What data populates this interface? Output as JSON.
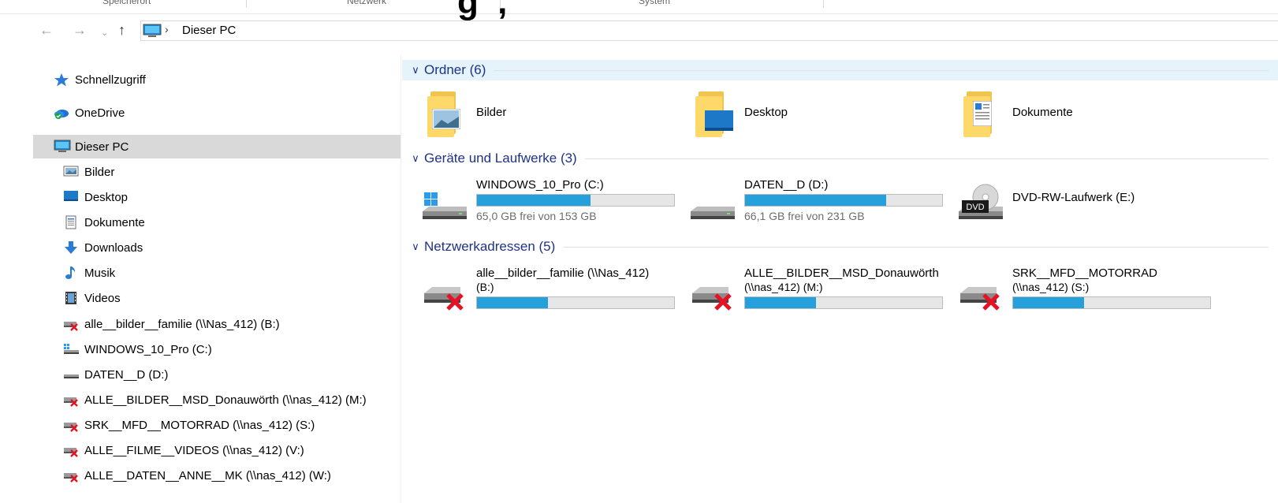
{
  "top_strip": {
    "labels": [
      "Speicherort",
      "Netzwerk",
      "System"
    ],
    "overlay_text": "g    ,"
  },
  "address": {
    "path": "Dieser PC"
  },
  "sidebar": {
    "items": [
      {
        "label": "Schnellzugriff",
        "icon": "star-icon"
      },
      {
        "label": "OneDrive",
        "icon": "onedrive-cloud-icon"
      },
      {
        "label": "Dieser PC",
        "icon": "this-pc-icon",
        "selected": true
      },
      {
        "label": "Bilder",
        "icon": "pictures-icon"
      },
      {
        "label": "Desktop",
        "icon": "desktop-icon"
      },
      {
        "label": "Dokumente",
        "icon": "documents-icon"
      },
      {
        "label": "Downloads",
        "icon": "downloads-icon"
      },
      {
        "label": "Musik",
        "icon": "music-icon"
      },
      {
        "label": "Videos",
        "icon": "videos-icon"
      },
      {
        "label": "alle__bilder__familie (\\\\Nas_412) (B:)",
        "icon": "disconnected-network-drive-icon"
      },
      {
        "label": "WINDOWS_10_Pro (C:)",
        "icon": "windows-drive-icon"
      },
      {
        "label": "DATEN__D (D:)",
        "icon": "drive-icon"
      },
      {
        "label": "ALLE__BILDER__MSD_Donauwörth (\\\\nas_412) (M:)",
        "icon": "disconnected-network-drive-icon"
      },
      {
        "label": "SRK__MFD__MOTORRAD (\\\\nas_412) (S:)",
        "icon": "disconnected-network-drive-icon"
      },
      {
        "label": "ALLE__FILME__VIDEOS (\\\\nas_412) (V:)",
        "icon": "disconnected-network-drive-icon"
      },
      {
        "label": "ALLE__DATEN__ANNE__MK (\\\\nas_412) (W:)",
        "icon": "disconnected-network-drive-icon"
      }
    ]
  },
  "groups": {
    "folders": {
      "title": "Ordner (6)",
      "items": [
        {
          "name": "Bilder",
          "icon": "pictures-folder-icon"
        },
        {
          "name": "Desktop",
          "icon": "desktop-folder-icon"
        },
        {
          "name": "Dokumente",
          "icon": "documents-folder-icon"
        }
      ]
    },
    "devices": {
      "title": "Geräte und Laufwerke (3)",
      "items": [
        {
          "name": "WINDOWS_10_Pro (C:)",
          "free": "65,0 GB frei von 153 GB",
          "used_fraction": 0.575,
          "icon": "windows-drive-icon"
        },
        {
          "name": "DATEN__D (D:)",
          "free": "66,1 GB frei von 231 GB",
          "used_fraction": 0.714,
          "icon": "drive-icon"
        },
        {
          "name": "DVD-RW-Laufwerk (E:)",
          "icon": "dvd-drive-icon",
          "icon_label": "DVD"
        }
      ]
    },
    "network": {
      "title": "Netzwerkadressen (5)",
      "items": [
        {
          "name": "alle__bilder__familie (\\\\Nas_412)",
          "name2": "(B:)",
          "used_fraction": 0.36,
          "icon": "disconnected-network-drive-icon"
        },
        {
          "name": "ALLE__BILDER__MSD_Donauwörth",
          "name2": "(\\\\nas_412) (M:)",
          "used_fraction": 0.36,
          "icon": "disconnected-network-drive-icon"
        },
        {
          "name": "SRK__MFD__MOTORRAD",
          "name2": "(\\\\nas_412) (S:)",
          "used_fraction": 0.36,
          "icon": "disconnected-network-drive-icon"
        }
      ]
    }
  },
  "colors": {
    "accent": "#26a0da",
    "group_title": "#1e3287",
    "selection": "#d9d9d9",
    "header_highlight": "#e5f3fb",
    "error_red": "#e81123"
  }
}
